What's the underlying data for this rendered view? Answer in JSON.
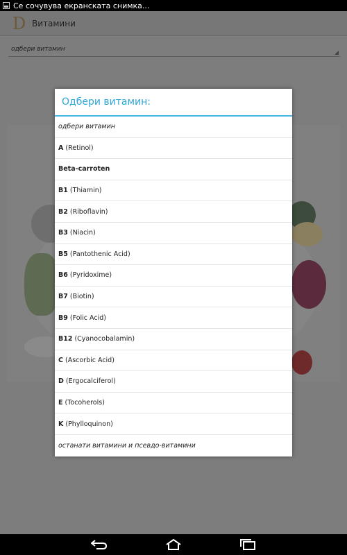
{
  "status_bar": {
    "text": "Се сочувува екранската снимка..."
  },
  "action_bar": {
    "logo_letter": "D",
    "title": "Витамини"
  },
  "spinner": {
    "selected": "одбери витамин"
  },
  "dialog": {
    "title": "Одбери витамин:",
    "items": [
      {
        "bold": "",
        "text": "одбери витамин",
        "italic": true
      },
      {
        "bold": "A",
        "text": "(Retinol)",
        "italic": false
      },
      {
        "bold": "Beta-carroten",
        "text": "",
        "italic": false
      },
      {
        "bold": "B1",
        "text": "(Thiamin)",
        "italic": false
      },
      {
        "bold": "B2",
        "text": "(Riboflavin)",
        "italic": false
      },
      {
        "bold": "B3",
        "text": "(Niacin)",
        "italic": false
      },
      {
        "bold": "B5",
        "text": "(Pantothenic Acid)",
        "italic": false
      },
      {
        "bold": "B6",
        "text": "(Pyridoxime)",
        "italic": false
      },
      {
        "bold": "B7",
        "text": "(Biotin)",
        "italic": false
      },
      {
        "bold": "B9",
        "text": "(Folic Acid)",
        "italic": false
      },
      {
        "bold": "B12",
        "text": "(Cyanocobalamin)",
        "italic": false
      },
      {
        "bold": "C",
        "text": "(Ascorbic Acid)",
        "italic": false
      },
      {
        "bold": "D",
        "text": "(Ergocalciferol)",
        "italic": false
      },
      {
        "bold": "E",
        "text": "(Tocoherols)",
        "italic": false
      },
      {
        "bold": "K",
        "text": "(Phylloquinon)",
        "italic": false
      },
      {
        "bold": "",
        "text": "останати витамини и псевдо-витамини",
        "italic": true
      }
    ]
  },
  "navbar": {
    "icons": [
      "back-icon",
      "home-icon",
      "recent-apps-icon"
    ]
  }
}
